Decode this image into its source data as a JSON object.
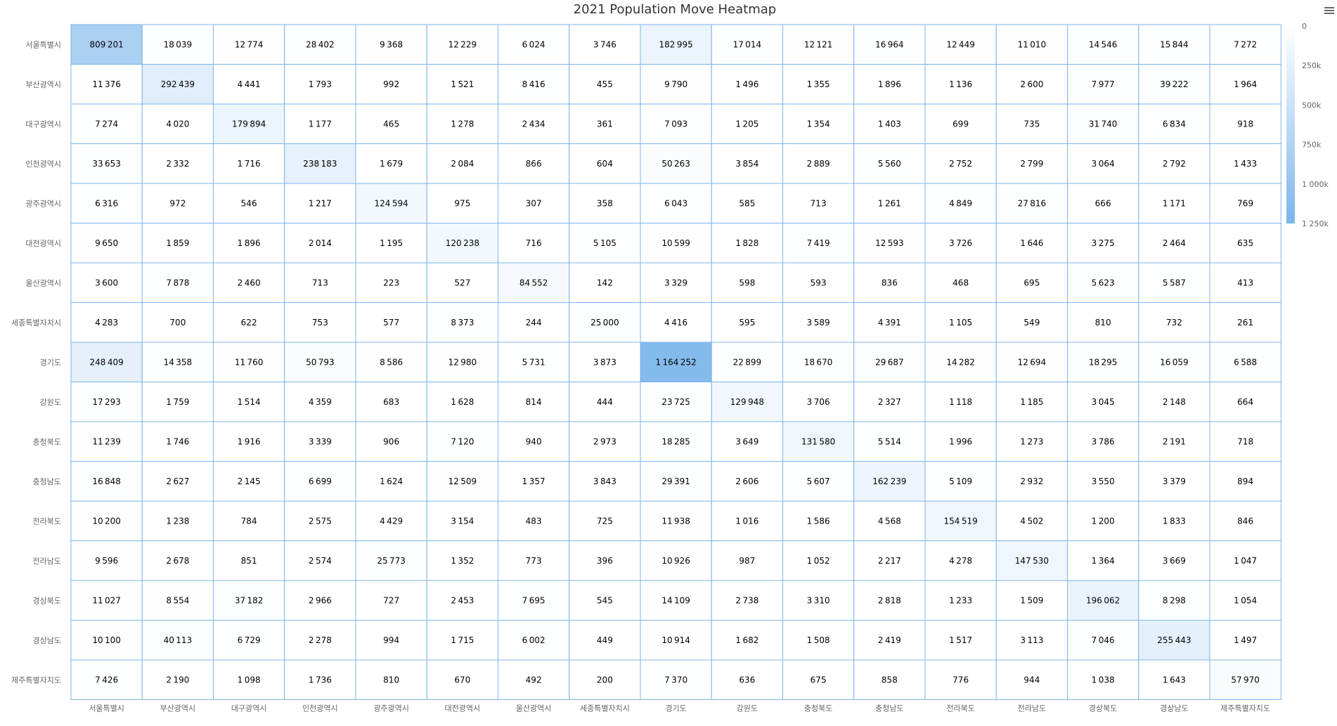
{
  "chart_data": {
    "type": "heatmap",
    "title": "2021 Population Move Heatmap",
    "x_categories": [
      "서울특별시",
      "부산광역시",
      "대구광역시",
      "인천광역시",
      "광주광역시",
      "대전광역시",
      "울산광역시",
      "세종특별자치시",
      "경기도",
      "강원도",
      "충청북도",
      "충청남도",
      "전라북도",
      "전라남도",
      "경상북도",
      "경상남도",
      "제주특별자치도"
    ],
    "y_categories": [
      "서울특별시",
      "부산광역시",
      "대구광역시",
      "인천광역시",
      "광주광역시",
      "대전광역시",
      "울산광역시",
      "세종특별자치시",
      "경기도",
      "강원도",
      "충청북도",
      "충청남도",
      "전라북도",
      "전라남도",
      "경상북도",
      "경상남도",
      "제주특별자치도"
    ],
    "values": [
      [
        809201,
        18039,
        12774,
        28402,
        9368,
        12229,
        6024,
        3746,
        182995,
        17014,
        12121,
        16964,
        12449,
        11010,
        14546,
        15844,
        7272
      ],
      [
        11376,
        292439,
        4441,
        1793,
        992,
        1521,
        8416,
        455,
        9790,
        1496,
        1355,
        1896,
        1136,
        2600,
        7977,
        39222,
        1964
      ],
      [
        7274,
        4020,
        179894,
        1177,
        465,
        1278,
        2434,
        361,
        7093,
        1205,
        1354,
        1403,
        699,
        735,
        31740,
        6834,
        918
      ],
      [
        33653,
        2332,
        1716,
        238183,
        1679,
        2084,
        866,
        604,
        50263,
        3854,
        2889,
        5560,
        2752,
        2799,
        3064,
        2792,
        1433
      ],
      [
        6316,
        972,
        546,
        1217,
        124594,
        975,
        307,
        358,
        6043,
        585,
        713,
        1261,
        4849,
        27816,
        666,
        1171,
        769
      ],
      [
        9650,
        1859,
        1896,
        2014,
        1195,
        120238,
        716,
        5105,
        10599,
        1828,
        7419,
        12593,
        3726,
        1646,
        3275,
        2464,
        635
      ],
      [
        3600,
        7878,
        2460,
        713,
        223,
        527,
        84552,
        142,
        3329,
        598,
        593,
        836,
        468,
        695,
        5623,
        5587,
        413
      ],
      [
        4283,
        700,
        622,
        753,
        577,
        8373,
        244,
        25000,
        4416,
        595,
        3589,
        4391,
        1105,
        549,
        810,
        732,
        261
      ],
      [
        248409,
        14358,
        11760,
        50793,
        8586,
        12980,
        5731,
        3873,
        1164252,
        22899,
        18670,
        29687,
        14282,
        12694,
        18295,
        16059,
        6588
      ],
      [
        17293,
        1759,
        1514,
        4359,
        683,
        1628,
        814,
        444,
        23725,
        129948,
        3706,
        2327,
        1118,
        1185,
        3045,
        2148,
        664
      ],
      [
        11239,
        1746,
        1916,
        3339,
        906,
        7120,
        940,
        2973,
        18285,
        3649,
        131580,
        5514,
        1996,
        1273,
        3786,
        2191,
        718
      ],
      [
        16848,
        2627,
        2145,
        6699,
        1624,
        12509,
        1357,
        3843,
        29391,
        2606,
        5607,
        162239,
        5109,
        2932,
        3550,
        3379,
        894
      ],
      [
        10200,
        1238,
        784,
        2575,
        4429,
        3154,
        483,
        725,
        11938,
        1016,
        1586,
        4568,
        154519,
        4502,
        1200,
        1833,
        846
      ],
      [
        9596,
        2678,
        851,
        2574,
        25773,
        1352,
        773,
        396,
        10926,
        987,
        1052,
        2217,
        4278,
        147530,
        1364,
        3669,
        1047
      ],
      [
        11027,
        8554,
        37182,
        2966,
        727,
        2453,
        7695,
        545,
        14109,
        2738,
        3310,
        2818,
        1233,
        1509,
        196062,
        8298,
        1054
      ],
      [
        10100,
        40113,
        6729,
        2278,
        994,
        1715,
        6002,
        449,
        10914,
        1682,
        1508,
        2419,
        1517,
        3113,
        7046,
        255443,
        1497
      ],
      [
        7426,
        2190,
        1098,
        1736,
        810,
        670,
        492,
        200,
        7370,
        636,
        675,
        858,
        776,
        944,
        1038,
        1643,
        57970
      ]
    ],
    "color_scale": {
      "min": 0,
      "max": 1250000,
      "min_color": "#ffffff",
      "max_color": "#7cb5ec",
      "ticks": [
        0,
        250000,
        500000,
        750000,
        1000000,
        1250000
      ],
      "tick_labels": [
        "0",
        "250k",
        "500k",
        "750k",
        "1 000k",
        "1 250k"
      ],
      "position": "right"
    },
    "cell_border_color": "#7cb5ec"
  }
}
